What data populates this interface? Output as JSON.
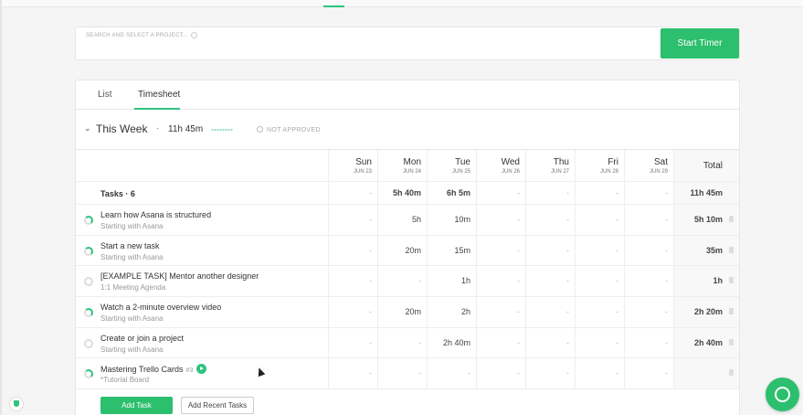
{
  "search": {
    "label": "SEARCH AND SELECT A PROJECT..."
  },
  "timer": {
    "start_label": "Start Timer"
  },
  "tabs": [
    {
      "label": "List"
    },
    {
      "label": "Timesheet"
    }
  ],
  "week": {
    "title": "This Week",
    "separator": "·",
    "total": "11h 45m",
    "approval": "NOT APPROVED"
  },
  "columns": [
    {
      "day": "Sun",
      "date": "JUN 23"
    },
    {
      "day": "Mon",
      "date": "JUN 24"
    },
    {
      "day": "Tue",
      "date": "JUN 25"
    },
    {
      "day": "Wed",
      "date": "JUN 26"
    },
    {
      "day": "Thu",
      "date": "JUN 27"
    },
    {
      "day": "Fri",
      "date": "JUN 28"
    },
    {
      "day": "Sat",
      "date": "JUN 29"
    }
  ],
  "total_label": "Total",
  "summary": {
    "label": "Tasks · 6",
    "values": [
      "-",
      "5h 40m",
      "6h 5m",
      "-",
      "-",
      "-",
      "-"
    ],
    "total": "11h 45m"
  },
  "tasks": [
    {
      "title": "Learn how Asana is structured",
      "project": "Starting with Asana",
      "values": [
        "-",
        "5h",
        "10m",
        "-",
        "-",
        "-",
        "-"
      ],
      "total": "5h 10m",
      "active": true
    },
    {
      "title": "Start a new task",
      "project": "Starting with Asana",
      "values": [
        "-",
        "20m",
        "15m",
        "-",
        "-",
        "-",
        "-"
      ],
      "total": "35m",
      "active": true
    },
    {
      "title": "[EXAMPLE TASK] Mentor another designer",
      "project": "1:1 Meeting Agenda",
      "values": [
        "-",
        "-",
        "1h",
        "-",
        "-",
        "-",
        "-"
      ],
      "total": "1h",
      "active": false
    },
    {
      "title": "Watch a 2-minute overview video",
      "project": "Starting with Asana",
      "values": [
        "-",
        "20m",
        "2h",
        "-",
        "-",
        "-",
        "-"
      ],
      "total": "2h 20m",
      "active": true
    },
    {
      "title": "Create or join a project",
      "project": "Starting with Asana",
      "values": [
        "-",
        "-",
        "2h 40m",
        "-",
        "-",
        "-",
        "-"
      ],
      "total": "2h 40m",
      "active": false
    },
    {
      "title": "Mastering Trello Cards",
      "tag": "#3",
      "project": "*Tutorial Board",
      "values": [
        "-",
        "-",
        "-",
        "-",
        "-",
        "-",
        "-"
      ],
      "total": "",
      "active": true,
      "playing": true
    }
  ],
  "footer": {
    "add_task": "Add Task",
    "add_recent": "Add Recent Tasks"
  },
  "colors": {
    "accent": "#2cbf6d"
  }
}
